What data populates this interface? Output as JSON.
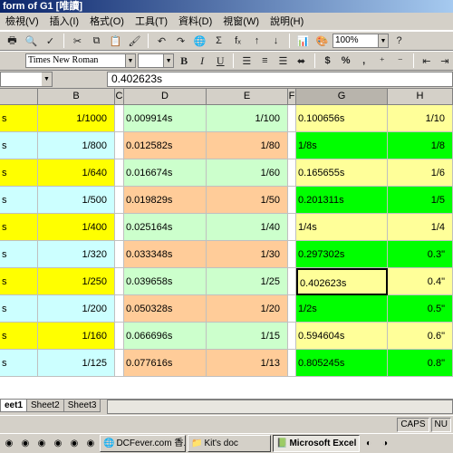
{
  "window": {
    "title": "form of G1  [唯讀]"
  },
  "menu": [
    "檢視(V)",
    "插入(I)",
    "格式(O)",
    "工具(T)",
    "資料(D)",
    "視窗(W)",
    "說明(H)"
  ],
  "toolbar": {
    "zoom": "100%",
    "font_name": "Times New Roman",
    "bold": "B",
    "italic": "I",
    "underline": "U",
    "currency": "$",
    "percent": "%",
    "comma": ",",
    "sigma": "Σ",
    "fx": "fₓ"
  },
  "formula_bar": {
    "value": "0.402623s"
  },
  "columns": [
    "B",
    "C",
    "D",
    "E",
    "F",
    "G",
    "H"
  ],
  "rows": [
    {
      "a": "s",
      "b": "1/1000",
      "d": "0.009914s",
      "e": "1/100",
      "g": "0.100656s",
      "h": "1/10"
    },
    {
      "a": "s",
      "b": "1/800",
      "d": "0.012582s",
      "e": "1/80",
      "g": "1/8s",
      "h": "1/8"
    },
    {
      "a": "s",
      "b": "1/640",
      "d": "0.016674s",
      "e": "1/60",
      "g": "0.165655s",
      "h": "1/6"
    },
    {
      "a": "s",
      "b": "1/500",
      "d": "0.019829s",
      "e": "1/50",
      "g": "0.201311s",
      "h": "1/5"
    },
    {
      "a": "s",
      "b": "1/400",
      "d": "0.025164s",
      "e": "1/40",
      "g": "1/4s",
      "h": "1/4"
    },
    {
      "a": "s",
      "b": "1/320",
      "d": "0.033348s",
      "e": "1/30",
      "g": "0.297302s",
      "h": "0.3\""
    },
    {
      "a": "s",
      "b": "1/250",
      "d": "0.039658s",
      "e": "1/25",
      "g": "0.402623s",
      "h": "0.4\""
    },
    {
      "a": "s",
      "b": "1/200",
      "d": "0.050328s",
      "e": "1/20",
      "g": "1/2s",
      "h": "0.5\""
    },
    {
      "a": "s",
      "b": "1/160",
      "d": "0.066696s",
      "e": "1/15",
      "g": "0.594604s",
      "h": "0.6\""
    },
    {
      "a": "s",
      "b": "1/125",
      "d": "0.077616s",
      "e": "1/13",
      "g": "0.805245s",
      "h": "0.8\""
    }
  ],
  "colors": {
    "yellow": "#ffff00",
    "light_cyan": "#ccffff",
    "light_green": "#ccffcc",
    "peach": "#ffcc99",
    "light_yellow": "#ffff99",
    "bright_green": "#00ff00"
  },
  "sheets": [
    "eet1",
    "Sheet2",
    "Sheet3"
  ],
  "status": {
    "caps": "CAPS",
    "num": "NU"
  },
  "taskbar": [
    "DCFever.com 香...",
    "Kit's doc",
    "Microsoft Excel -..."
  ]
}
